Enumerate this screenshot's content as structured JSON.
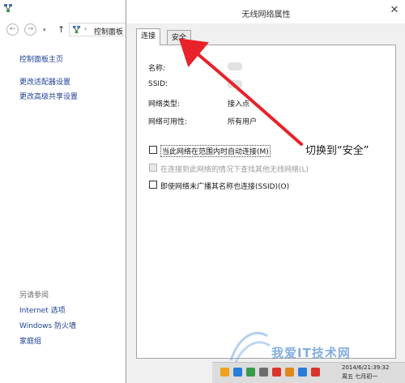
{
  "background_window": {
    "address_path": "控制面板",
    "address_sep": "›",
    "nav": {
      "back_glyph": "←",
      "forward_glyph": "→",
      "dropdown_glyph": "▾",
      "up_glyph": "↑"
    },
    "left_pane": {
      "home": "控制面板主页",
      "change_adapter": "更改适配器设置",
      "change_sharing": "更改高级共享设置",
      "see_also": "另请参阅",
      "internet_options": "Internet 选项",
      "firewall": "Windows 防火墙",
      "homegroup": "家庭组"
    }
  },
  "dialog": {
    "title": "无线网络属性",
    "close_glyph": "✕",
    "tabs": [
      {
        "label": "连接",
        "selected": true
      },
      {
        "label": "安全",
        "selected": false
      }
    ],
    "properties": [
      {
        "label": "名称:",
        "value": ""
      },
      {
        "label": "SSID:",
        "value": ""
      },
      {
        "label": "网络类型:",
        "value": "接入点"
      },
      {
        "label": "网络可用性:",
        "value": "所有用户"
      }
    ],
    "options": [
      {
        "text": "当此网络在范围内时自动连接(M)",
        "checked": false,
        "enabled": true
      },
      {
        "text": "在连接到此网络的情况下查找其他无线网络(L)",
        "checked": false,
        "enabled": false
      },
      {
        "text": "即使网络未广播其名称也连接(SSID)(O)",
        "checked": false,
        "enabled": true
      }
    ]
  },
  "annotation": {
    "text": "切换到“安全”",
    "arrow_color": "#e8222a"
  },
  "taskbar": {
    "clock_line1": "21:39:32",
    "clock_line2": "周五    七月初一",
    "clock_prefix": "2014/6/",
    "icon_colors": [
      "#f0a21b",
      "#2b7bd8",
      "#3a9b4c",
      "#d9342b",
      "#6d6d6d",
      "#e0861a",
      "#2b7bd8",
      "#d9342b"
    ]
  },
  "watermark": "我爱IT技术网",
  "colors": {
    "link": "#1c3f94",
    "dialog_bg": "#f0f0f0",
    "accent_arrow": "#e8222a"
  }
}
